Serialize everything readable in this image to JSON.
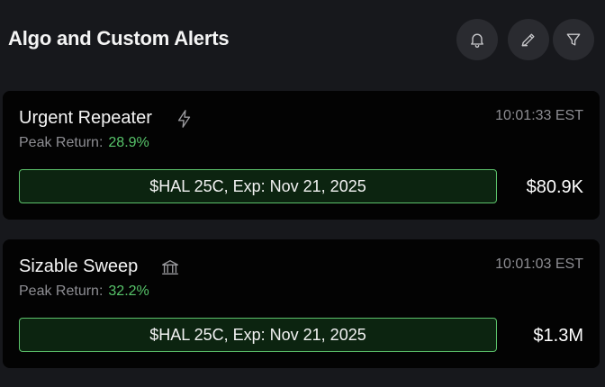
{
  "header": {
    "title": "Algo and Custom Alerts",
    "icons": [
      "bell-icon",
      "edit-icon",
      "filter-icon"
    ]
  },
  "alerts": [
    {
      "title": "Urgent Repeater",
      "type_icon": "lightning-icon",
      "time": "10:01:33 EST",
      "peak_label": "Peak Return:",
      "peak_value": "28.9%",
      "contract": "$HAL 25C, Exp: Nov 21, 2025",
      "premium": "$80.9K"
    },
    {
      "title": "Sizable Sweep",
      "type_icon": "bank-icon",
      "time": "10:01:03 EST",
      "peak_label": "Peak Return:",
      "peak_value": "32.2%",
      "contract": "$HAL 25C, Exp: Nov 21, 2025",
      "premium": "$1.3M"
    }
  ],
  "colors": {
    "background": "#17181c",
    "card": "#030303",
    "positive": "#57c46a",
    "pill_fill": "#0c2410",
    "pill_border": "#5cc26b"
  }
}
